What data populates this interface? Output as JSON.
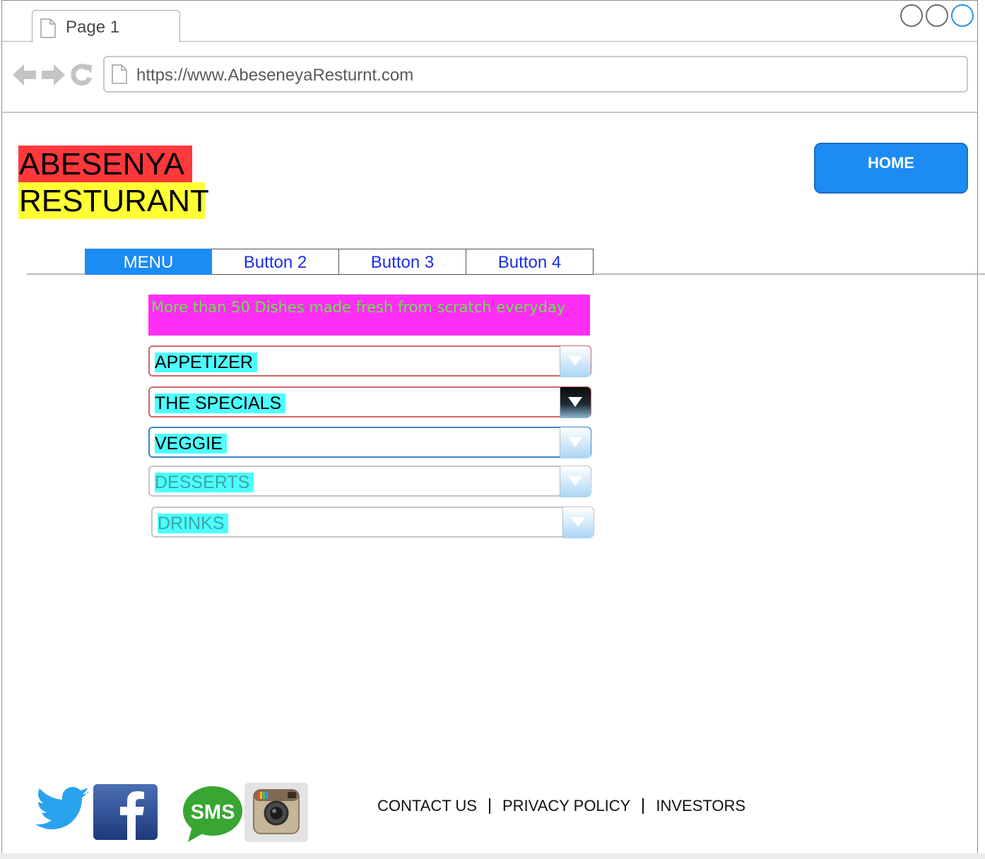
{
  "browser": {
    "tab_title": "Page 1",
    "url": "https://www.AbeseneyaResturnt.com"
  },
  "header": {
    "logo_line1": "ABESENYA",
    "logo_line2": "RESTURANT",
    "home_label": "HOME"
  },
  "nav": {
    "tabs": [
      {
        "label": "MENU",
        "active": true
      },
      {
        "label": "Button 2",
        "active": false
      },
      {
        "label": "Button 3",
        "active": false
      },
      {
        "label": "Button 4",
        "active": false
      }
    ]
  },
  "banner": {
    "text": "More than 50 Dishes made fresh from scratch everyday"
  },
  "categories": [
    {
      "label": "APPETIZER"
    },
    {
      "label": "THE SPECIALS"
    },
    {
      "label": "VEGGIE"
    },
    {
      "label": "DESSERTS"
    },
    {
      "label": "DRINKS"
    }
  ],
  "footer": {
    "social": [
      "twitter-icon",
      "facebook-icon",
      "sms-icon",
      "instagram-icon"
    ],
    "sms_label": "SMS",
    "links": [
      "CONTACT US",
      "PRIVACY POLICY",
      "INVESTORS"
    ]
  },
  "colors": {
    "logo_red": "#ff383b",
    "logo_yellow": "#ffff33",
    "accent_blue": "#1c8bf2",
    "banner_magenta": "#ff2ef5",
    "banner_text_green": "#6be34a",
    "category_highlight_cyan": "#4dffff"
  }
}
